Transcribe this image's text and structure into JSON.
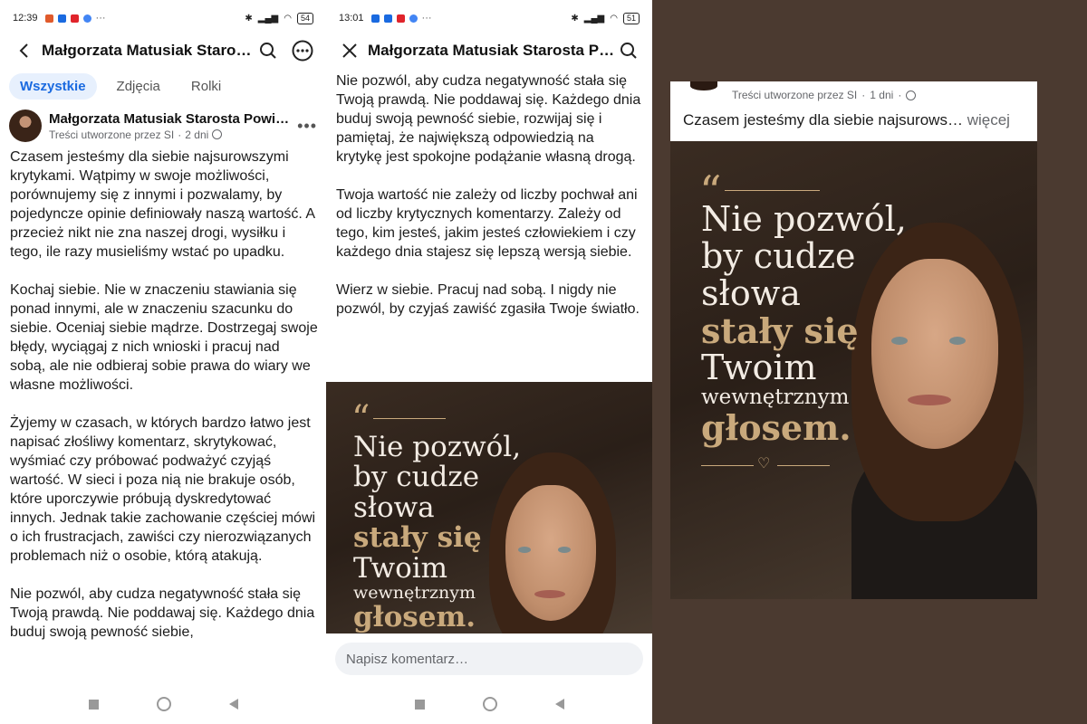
{
  "screen1": {
    "status": {
      "time": "12:39",
      "battery": "54"
    },
    "title": "Małgorzata Matusiak Starosta Powiatu",
    "tabs": [
      "Wszystkie",
      "Zdjęcia",
      "Rolki"
    ],
    "post": {
      "author": "Małgorzata Matusiak Starosta Powiatu",
      "meta_source": "Treści utworzone przez SI",
      "meta_time": "2 dni",
      "paragraphs": [
        "Czasem jesteśmy dla siebie najsurowszymi krytykami. Wątpimy w swoje możliwości, porównujemy się z innymi i pozwalamy, by pojedyncze opinie definiowały naszą wartość. A przecież nikt nie zna naszej drogi, wysiłku i tego, ile razy musieliśmy wstać po upadku.",
        "Kochaj siebie. Nie w znaczeniu stawiania się ponad innymi, ale w znaczeniu szacunku do siebie. Oceniaj siebie mądrze. Dostrzegaj swoje błędy, wyciągaj z nich wnioski i pracuj nad sobą, ale nie odbieraj sobie prawa do wiary we własne możliwości.",
        "Żyjemy w czasach, w których bardzo łatwo jest napisać złośliwy komentarz, skrytykować, wyśmiać czy próbować podważyć czyjąś wartość. W sieci i poza nią nie brakuje osób, które uporczywie próbują dyskredytować innych. Jednak takie zachowanie częściej mówi o ich frustracjach, zawiści czy nierozwiązanych problemach niż o osobie, którą atakują.",
        "Nie pozwól, aby cudza negatywność stała się Twoją prawdą. Nie poddawaj się. Każdego dnia buduj swoją pewność siebie,"
      ]
    }
  },
  "screen2": {
    "status": {
      "time": "13:01",
      "battery": "51"
    },
    "title": "Małgorzata Matusiak Starosta Powiatu",
    "paragraphs": [
      "Nie pozwól, aby cudza negatywność stała się Twoją prawdą. Nie poddawaj się. Każdego dnia buduj swoją pewność siebie, rozwijaj się i pamiętaj, że największą odpowiedzią na krytykę jest spokojne podążanie własną drogą.",
      "Twoja wartość nie zależy od liczby pochwał ani od liczby krytycznych komentarzy. Zależy od tego, kim jesteś, jakim jesteś człowiekiem i czy każdego dnia stajesz się lepszą wersją siebie.",
      "Wierz w siebie. Pracuj nad sobą. I nigdy nie pozwól, by czyjaś zawiść zgasiła Twoje światło."
    ],
    "comment_placeholder": "Napisz komentarz…"
  },
  "screen3": {
    "meta_source": "Treści utworzone przez SI",
    "meta_time": "1 dni",
    "caption": "Czasem jesteśmy dla siebie najsurows…",
    "more": "więcej"
  },
  "graphic": {
    "quote_mark": "“",
    "lines": [
      "Nie pozwól,",
      "by cudze",
      "słowa"
    ],
    "gold1": "stały się",
    "line4": "Twoim",
    "line5": "wewnętrznym",
    "gold2": "głosem.",
    "heart": "♡"
  },
  "colors": {
    "accent": "#1a6ae0",
    "gold": "#c9a97c",
    "bg_brown": "#4b3a30"
  }
}
